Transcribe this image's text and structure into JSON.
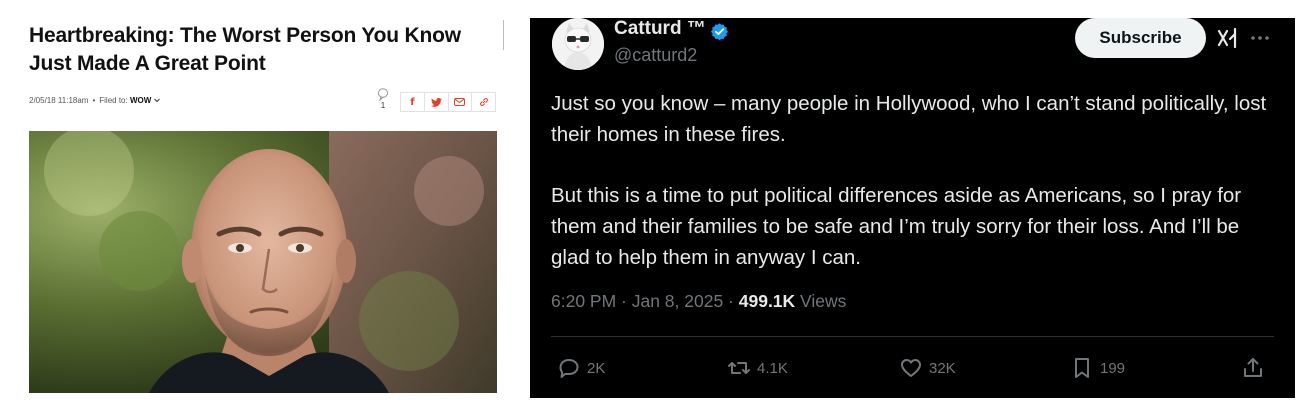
{
  "article": {
    "headline": "Heartbreaking: The Worst Person You Know Just Made A Great Point",
    "date": "2/05/18 11:18am",
    "filed_label": "Filed to:",
    "filed_value": "WOW",
    "comment_count": "1",
    "share": {
      "facebook": "f",
      "twitter": "t",
      "email": "email",
      "link": "link"
    },
    "icons": [
      "comment-icon",
      "facebook-icon",
      "twitter-icon",
      "email-icon",
      "link-icon",
      "chevron-down-icon"
    ]
  },
  "tweet": {
    "display_name": "Catturd ™",
    "handle": "@catturd2",
    "subscribe_label": "Subscribe",
    "paragraphs": [
      "Just so you know – many people in Hollywood, who I can’t stand politically, lost their homes in these fires.",
      "But this is a time to put political differences aside as Americans, so I pray for them and their families to be safe and I’m truly sorry for their loss. And I’ll be glad to help them in anyway I can."
    ],
    "timestamp": "6:20 PM · Jan 8, 2025 · ",
    "views_count": "499.1K",
    "views_label": " Views",
    "actions": {
      "replies": "2K",
      "reposts": "4.1K",
      "likes": "32K",
      "bookmarks": "199"
    },
    "colors": {
      "background": "#000000",
      "text": "#e7e9ea",
      "muted": "#71767b",
      "verified": "#1d9bf0"
    },
    "icons": [
      "verified-badge-icon",
      "grok-icon",
      "more-icon",
      "reply-icon",
      "repost-icon",
      "like-icon",
      "bookmark-icon",
      "share-icon"
    ]
  }
}
